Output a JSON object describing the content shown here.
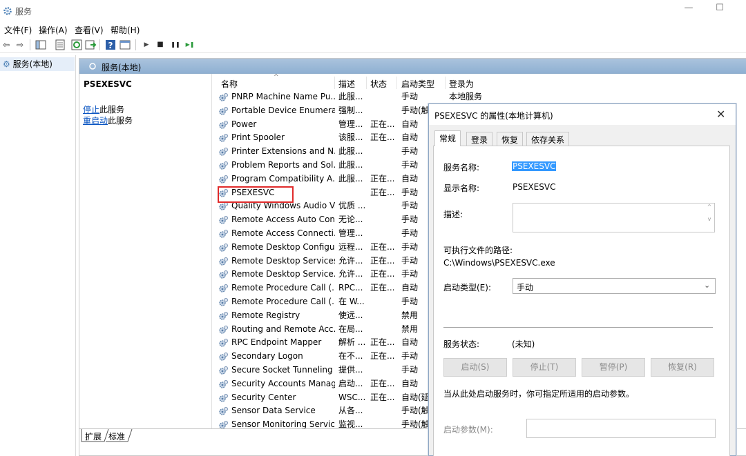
{
  "window": {
    "title": "服务",
    "minimize": "—",
    "maximize": "☐"
  },
  "menu": [
    "文件(F)",
    "操作(A)",
    "查看(V)",
    "帮助(H)"
  ],
  "toolbar": {
    "back": "⇦",
    "forward": "⇨",
    "play": "▶",
    "stop": "■",
    "pause": "❚❚",
    "restart": "▶❚"
  },
  "tree": {
    "root": "服务(本地)"
  },
  "pane": {
    "header": "服务(本地)"
  },
  "extended": {
    "service_name": "PSEXESVC",
    "stop_link": "停止",
    "stop_rest": "此服务",
    "restart_link": "重启动",
    "restart_rest": "此服务"
  },
  "columns": {
    "name": "名称",
    "desc": "描述",
    "status": "状态",
    "startup": "启动类型",
    "logon": "登录为",
    "sort_arrow": "^"
  },
  "services": [
    {
      "name": "PNRP Machine Name Pu...",
      "desc": "此服...",
      "status": "",
      "startup": "手动",
      "logon": "本地服务"
    },
    {
      "name": "Portable Device Enumera...",
      "desc": "强制...",
      "status": "",
      "startup": "手动(触",
      "logon": ""
    },
    {
      "name": "Power",
      "desc": "管理...",
      "status": "正在...",
      "startup": "自动",
      "logon": ""
    },
    {
      "name": "Print Spooler",
      "desc": "该服...",
      "status": "正在...",
      "startup": "自动",
      "logon": ""
    },
    {
      "name": "Printer Extensions and N...",
      "desc": "此服...",
      "status": "",
      "startup": "手动",
      "logon": ""
    },
    {
      "name": "Problem Reports and Sol...",
      "desc": "此服...",
      "status": "",
      "startup": "手动",
      "logon": ""
    },
    {
      "name": "Program Compatibility A...",
      "desc": "此服...",
      "status": "正在...",
      "startup": "自动",
      "logon": ""
    },
    {
      "name": "PSEXESVC",
      "desc": "",
      "status": "正在...",
      "startup": "手动",
      "logon": ""
    },
    {
      "name": "Quality Windows Audio V...",
      "desc": "优质 ...",
      "status": "",
      "startup": "手动",
      "logon": ""
    },
    {
      "name": "Remote Access Auto Con...",
      "desc": "无论...",
      "status": "",
      "startup": "手动",
      "logon": ""
    },
    {
      "name": "Remote Access Connecti...",
      "desc": "管理...",
      "status": "",
      "startup": "手动",
      "logon": ""
    },
    {
      "name": "Remote Desktop Configu...",
      "desc": "远程...",
      "status": "正在...",
      "startup": "手动",
      "logon": ""
    },
    {
      "name": "Remote Desktop Services",
      "desc": "允许...",
      "status": "正在...",
      "startup": "手动",
      "logon": ""
    },
    {
      "name": "Remote Desktop Service...",
      "desc": "允许...",
      "status": "正在...",
      "startup": "手动",
      "logon": ""
    },
    {
      "name": "Remote Procedure Call (...",
      "desc": "RPC...",
      "status": "正在...",
      "startup": "自动",
      "logon": ""
    },
    {
      "name": "Remote Procedure Call (...",
      "desc": "在 W...",
      "status": "",
      "startup": "手动",
      "logon": ""
    },
    {
      "name": "Remote Registry",
      "desc": "使远...",
      "status": "",
      "startup": "禁用",
      "logon": ""
    },
    {
      "name": "Routing and Remote Acc...",
      "desc": "在局...",
      "status": "",
      "startup": "禁用",
      "logon": ""
    },
    {
      "name": "RPC Endpoint Mapper",
      "desc": "解析 ...",
      "status": "正在...",
      "startup": "自动",
      "logon": ""
    },
    {
      "name": "Secondary Logon",
      "desc": "在不...",
      "status": "正在...",
      "startup": "手动",
      "logon": ""
    },
    {
      "name": "Secure Socket Tunneling ...",
      "desc": "提供...",
      "status": "",
      "startup": "手动",
      "logon": ""
    },
    {
      "name": "Security Accounts Manag...",
      "desc": "启动...",
      "status": "正在...",
      "startup": "自动",
      "logon": ""
    },
    {
      "name": "Security Center",
      "desc": "WSC...",
      "status": "正在...",
      "startup": "自动(延",
      "logon": ""
    },
    {
      "name": "Sensor Data Service",
      "desc": "从各...",
      "status": "",
      "startup": "手动(触",
      "logon": ""
    },
    {
      "name": "Sensor Monitoring Service",
      "desc": "监视...",
      "status": "",
      "startup": "手动(触",
      "logon": ""
    }
  ],
  "bottom_tabs": [
    "扩展",
    "标准"
  ],
  "dialog": {
    "title": "PSEXESVC 的属性(本地计算机)",
    "close": "✕",
    "tabs": [
      "常规",
      "登录",
      "恢复",
      "依存关系"
    ],
    "service_name_label": "服务名称:",
    "service_name": "PSEXESVC",
    "display_name_label": "显示名称:",
    "display_name": "PSEXESVC",
    "description_label": "描述:",
    "path_label": "可执行文件的路径:",
    "path": "C:\\Windows\\PSEXESVC.exe",
    "startup_label": "启动类型(E):",
    "startup_value": "手动",
    "status_label": "服务状态:",
    "status_value": "(未知)",
    "buttons": [
      "启动(S)",
      "停止(T)",
      "暂停(P)",
      "恢复(R)"
    ],
    "hint": "当从此处启动服务时，你可指定所适用的启动参数。",
    "params_label": "启动参数(M):"
  }
}
